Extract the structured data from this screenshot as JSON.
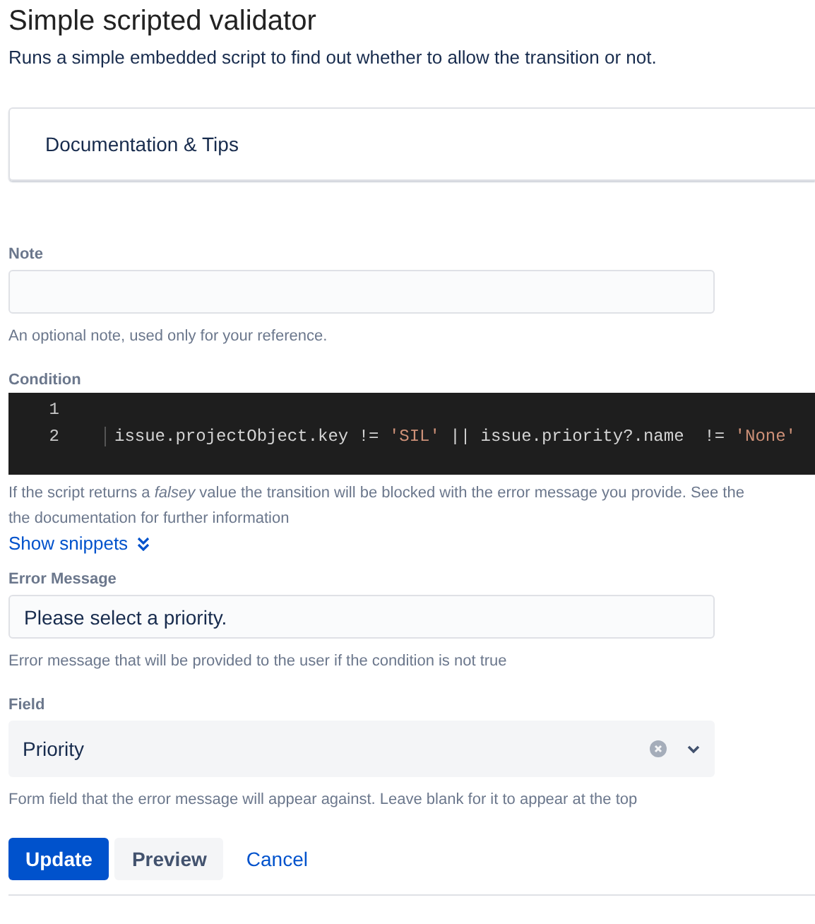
{
  "title": "Simple scripted validator",
  "description": "Runs a simple embedded script to find out whether to allow the transition or not.",
  "docs_panel": {
    "title": "Documentation & Tips",
    "expanded": false
  },
  "note": {
    "label": "Note",
    "help": "An optional note, used only for your reference."
  },
  "condition": {
    "label": "Condition",
    "lines": [
      {
        "number": "1"
      },
      {
        "number": "2",
        "tokens": [
          {
            "kind": "plain",
            "text": "issue.projectObject.key != "
          },
          {
            "kind": "string",
            "text": "'SIL'"
          },
          {
            "kind": "plain",
            "text": " || issue.priority?.name  != "
          },
          {
            "kind": "string",
            "text": "'None'"
          }
        ]
      }
    ],
    "help": "If the script returns a *falsey* value the transition will be blocked with the error message you provide. See the",
    "help_2": "the documentation for further information",
    "snippets_link": "Show snippets"
  },
  "error_message": {
    "label": "Error Message",
    "value": "Please select a priority.",
    "help": "Error message that will be provided to the user if the condition is not true"
  },
  "field": {
    "label": "Field",
    "value": "Priority",
    "help": "Form field that the error message will appear against. Leave blank for it to appear at the top"
  },
  "buttons": [
    {
      "label": "Update",
      "kind": "primary"
    },
    {
      "label": "Preview",
      "kind": "default"
    },
    {
      "label": "Cancel",
      "kind": "link"
    }
  ]
}
